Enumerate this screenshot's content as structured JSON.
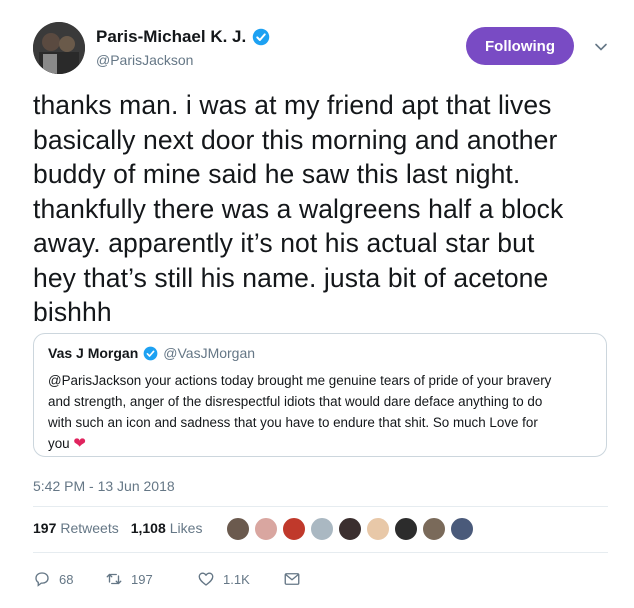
{
  "header": {
    "display_name": "Paris-Michael K. J.",
    "handle": "@ParisJackson",
    "follow_label": "Following"
  },
  "tweet": {
    "lines": [
      "thanks man. i was at my friend apt that lives",
      "basically next door this morning and another",
      "buddy of mine said he saw this last night.",
      "thankfully there was a walgreens half a block",
      "away. apparently it’s not his actual star but",
      "hey that’s still his name. justa bit of acetone",
      "bishhh"
    ]
  },
  "quote": {
    "display_name": "Vas J Morgan",
    "handle": "@VasJMorgan",
    "lines": [
      "@ParisJackson your actions today brought me genuine tears of pride of your bravery",
      "and strength, anger of the disrespectful idiots that would dare deface anything to do",
      "with such an icon and sadness that you have to endure that shit. So much Love for",
      "you"
    ],
    "heart": "❤"
  },
  "timestamp": "5:42 PM - 13 Jun 2018",
  "stats": {
    "retweets_count": "197",
    "retweets_label": "Retweets",
    "likes_count": "1,108",
    "likes_label": "Likes"
  },
  "likers": [
    {
      "color": "#6b5a4e"
    },
    {
      "color": "#d9a6a0"
    },
    {
      "color": "#c0392b"
    },
    {
      "color": "#aab8c2"
    },
    {
      "color": "#3b2f2f"
    },
    {
      "color": "#e8c8a8"
    },
    {
      "color": "#2c2c2c"
    },
    {
      "color": "#7a6a5a"
    },
    {
      "color": "#4a5a7a"
    }
  ],
  "actions": {
    "replies": "68",
    "retweets": "197",
    "likes": "1.1K"
  },
  "colors": {
    "accent": "#794bc4",
    "verified": "#1da1f2",
    "muted": "#657786"
  }
}
